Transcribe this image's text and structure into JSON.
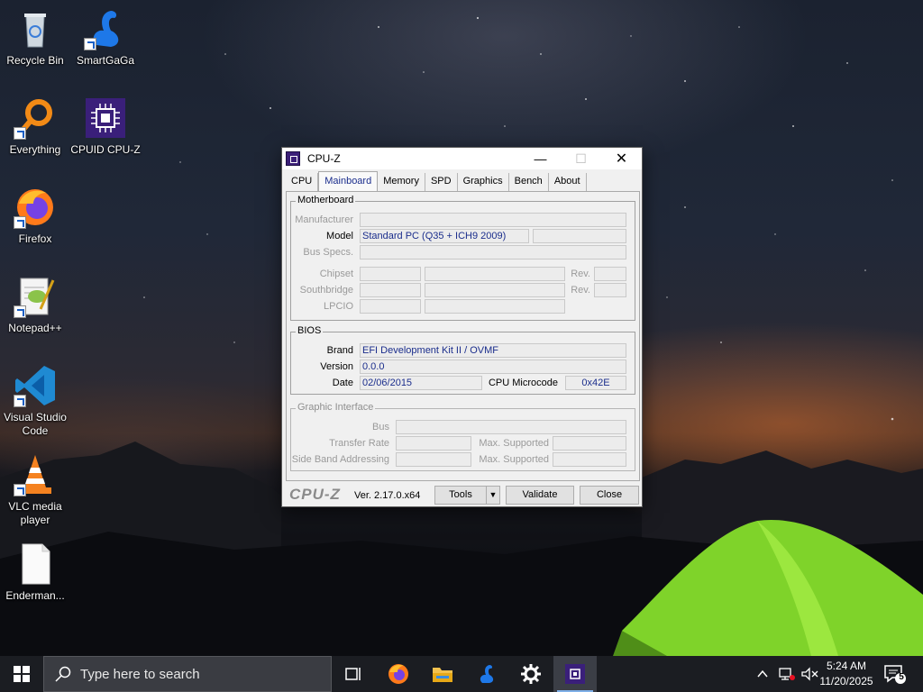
{
  "desktop": {
    "icons": [
      {
        "label": "Recycle Bin",
        "icon": "recycle-bin-icon"
      },
      {
        "label": "SmartGaGa",
        "icon": "swan-icon"
      },
      {
        "label": "Everything",
        "icon": "magnifier-icon"
      },
      {
        "label": "CPUID CPU-Z",
        "icon": "cpu-chip-icon"
      },
      {
        "label": "Firefox",
        "icon": "firefox-icon"
      },
      {
        "label": "Notepad++",
        "icon": "notepad-plus-plus-icon"
      },
      {
        "label": "Visual Studio Code",
        "icon": "vscode-icon"
      },
      {
        "label": "VLC media player",
        "icon": "vlc-cone-icon"
      },
      {
        "label": "Enderman...",
        "icon": "blank-file-icon"
      }
    ]
  },
  "window": {
    "title": "CPU-Z",
    "controls": {
      "minimize": "—",
      "maximize": "☐",
      "close": "✕"
    },
    "tabs": [
      {
        "label": "CPU"
      },
      {
        "label": "Mainboard",
        "active": true
      },
      {
        "label": "Memory"
      },
      {
        "label": "SPD"
      },
      {
        "label": "Graphics"
      },
      {
        "label": "Bench"
      },
      {
        "label": "About"
      }
    ],
    "motherboard": {
      "group_label": "Motherboard",
      "manufacturer_label": "Manufacturer",
      "manufacturer_value": "",
      "model_label": "Model",
      "model_value": "Standard PC (Q35 + ICH9 2009)",
      "model_extra": "",
      "bus_specs_label": "Bus Specs.",
      "bus_specs_value": "",
      "chipset_label": "Chipset",
      "southbridge_label": "Southbridge",
      "lpcio_label": "LPCIO",
      "rev_label": "Rev."
    },
    "bios": {
      "group_label": "BIOS",
      "brand_label": "Brand",
      "brand_value": "EFI Development Kit II / OVMF",
      "version_label": "Version",
      "version_value": "0.0.0",
      "date_label": "Date",
      "date_value": "02/06/2015",
      "microcode_label": "CPU Microcode",
      "microcode_value": "0x42E"
    },
    "graphic_interface": {
      "group_label": "Graphic Interface",
      "bus_label": "Bus",
      "transfer_rate_label": "Transfer Rate",
      "side_band_label": "Side Band Addressing",
      "max_supported_label": "Max. Supported"
    },
    "footer": {
      "logo": "CPU-Z",
      "version": "Ver. 2.17.0.x64",
      "tools_label": "Tools",
      "tools_arrow": "▼",
      "validate_label": "Validate",
      "close_label": "Close"
    }
  },
  "taskbar": {
    "search_placeholder": "Type here to search",
    "pinned": [
      {
        "name": "task-view",
        "icon": "task-view-icon"
      },
      {
        "name": "firefox",
        "icon": "firefox-icon"
      },
      {
        "name": "file-explorer",
        "icon": "folder-icon"
      },
      {
        "name": "smartgaga",
        "icon": "swan-icon"
      },
      {
        "name": "settings",
        "icon": "gear-icon"
      },
      {
        "name": "cpu-z",
        "icon": "cpu-chip-icon",
        "active": true
      }
    ],
    "time": "5:24 AM",
    "date": "11/20/2025",
    "notification_count": "5"
  }
}
